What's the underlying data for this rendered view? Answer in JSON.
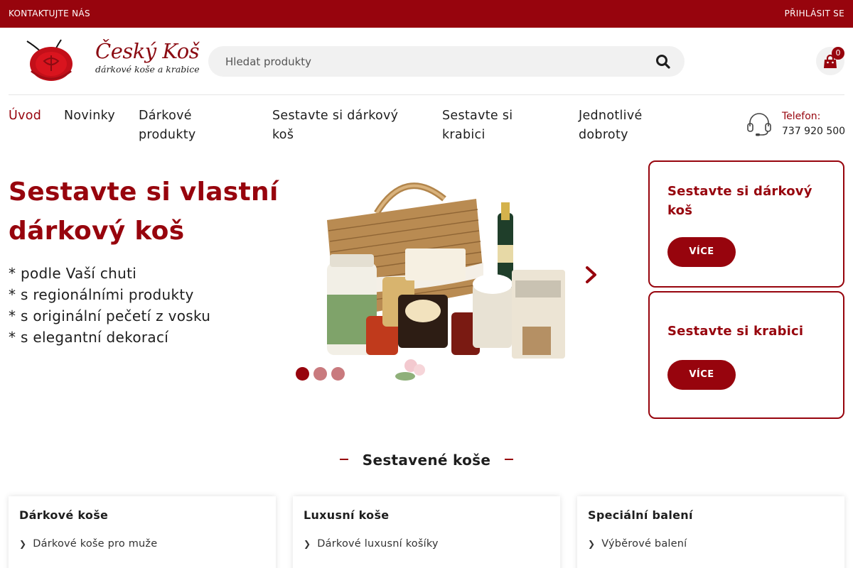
{
  "topbar": {
    "contact": "KONTAKTUJTE NÁS",
    "login": "PŘIHLÁSIT SE"
  },
  "logo": {
    "brand": "Český Koš",
    "tagline": "dárkové koše a krabice"
  },
  "search": {
    "placeholder": "Hledat produkty",
    "icon": "search-icon"
  },
  "cart": {
    "count": "0",
    "icon": "shopping-bag-icon"
  },
  "nav": {
    "items": [
      {
        "label": "Úvod",
        "active": true
      },
      {
        "label": "Novinky"
      },
      {
        "label": "Dárkové produkty"
      },
      {
        "label": "Sestavte si dárkový koš"
      },
      {
        "label": "Sestavte si krabici"
      },
      {
        "label": "Jednotlivé dobroty"
      }
    ]
  },
  "phone": {
    "label": "Telefon:",
    "number": "737 920 500",
    "icon": "headset-icon"
  },
  "hero": {
    "title": "Sestavte si vlastní dárkový koš",
    "lines": [
      "* podle Vaší chuti",
      "* s regionálními produkty",
      "* s originální pečetí z vosku",
      "* s elegantní dekorací"
    ],
    "slide_count": 3,
    "active_slide": 1
  },
  "promos": [
    {
      "title": "Sestavte si dárkový koš",
      "button": "VÍCE"
    },
    {
      "title": "Sestavte si krabici",
      "button": "VÍCE"
    }
  ],
  "section": {
    "title": "Sestavené koše"
  },
  "cards": [
    {
      "title": "Dárkové koše",
      "link": "Dárkové koše pro muže"
    },
    {
      "title": "Luxusní koše",
      "link": "Dárkové luxusní košíky"
    },
    {
      "title": "Speciální balení",
      "link": "Výběrové balení"
    }
  ],
  "colors": {
    "brand": "#97040d",
    "search_bg": "#f1f1f1",
    "dot_inactive": "#c97a7e"
  }
}
